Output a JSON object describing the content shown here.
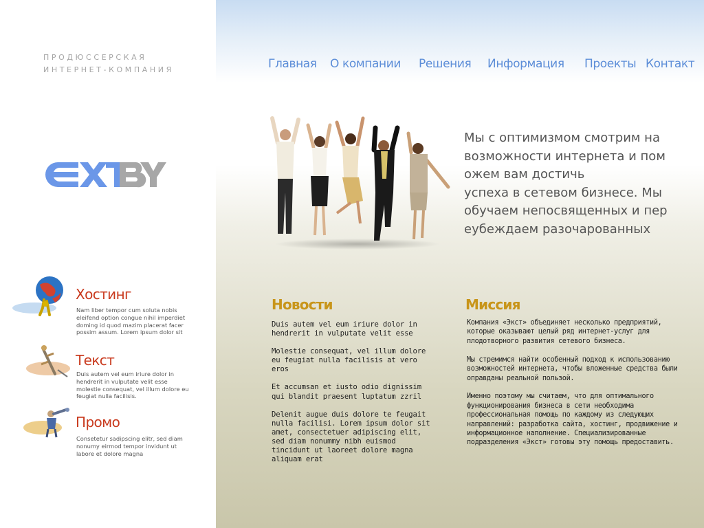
{
  "tagline": [
    "ПРОДЮССЕРСКАЯ",
    "ИНТЕРНЕТ-КОМПАНИЯ"
  ],
  "nav": [
    "Главная",
    "О компании",
    "Решения",
    "Информация",
    "Проекты",
    "Контакт"
  ],
  "logo": {
    "part1": "EXT",
    "part2": "BY",
    "color1": "#6b97e8",
    "color2": "#a7a7a7"
  },
  "intro": [
    "Мы с оптимизмом смотрим на",
    "возможности интернета и пом",
    "ожем вам достичь",
    "успеха в сетевом бизнесе. Мы",
    "обучаем непосвященных и пер",
    "еубеждаем разочарованных"
  ],
  "services": [
    {
      "title": "Хостинг",
      "icon": "globe-carrier-icon",
      "text": "Nam liber tempor cum soluta nobis eleifend option congue nihil imperdiet doming id quod mazim placerat facer possim assum. Lorem ipsum dolor sit"
    },
    {
      "title": "Текст",
      "icon": "writer-figure-icon",
      "text": "Duis autem vel eum iriure dolor in hendrerit in vulputate velit esse molestie consequat, vel illum dolore eu feugiat nulla facilisis."
    },
    {
      "title": "Промо",
      "icon": "telescope-figure-icon",
      "text": "Consetetur sadipscing elitr, sed diam nonumy eirmod tempor invidunt ut labore et dolore magna"
    }
  ],
  "news": {
    "title": "Новости",
    "items": [
      "Duis autem vel eum iriure dolor in hendrerit in vulputate velit esse",
      "Molestie consequat, vel illum dolore eu feugiat nulla facilisis at vero eros",
      "Et accumsan et iusto odio dignissim qui blandit praesent luptatum zzril",
      "Delenit augue duis dolore te feugait nulla facilisi. Lorem ipsum dolor sit amet, consectetuer adipiscing elit, sed diam nonummy nibh euismod tincidunt ut laoreet dolore magna aliquam erat"
    ]
  },
  "mission": {
    "title": "Миссия",
    "paragraphs": [
      "Компания «Экст» объединяет несколько предприятий, которые оказывают целый ряд интернет-услуг для плодотворного развития сетевого бизнеса.",
      "Мы стремимся найти особенный подход к использованию возможностей интернета, чтобы вложенные средства были оправданы реальной пользой.",
      "Именно поэтому мы считаем, что для оптимального функционирования бизнеса в сети необходима профессиональная помощь по каждому из следующих направлений: разработка сайта, хостинг, продвижение и информационное наполнение. Специализированные подразделения «Экст» готовы эту помощь предоставить."
    ]
  }
}
